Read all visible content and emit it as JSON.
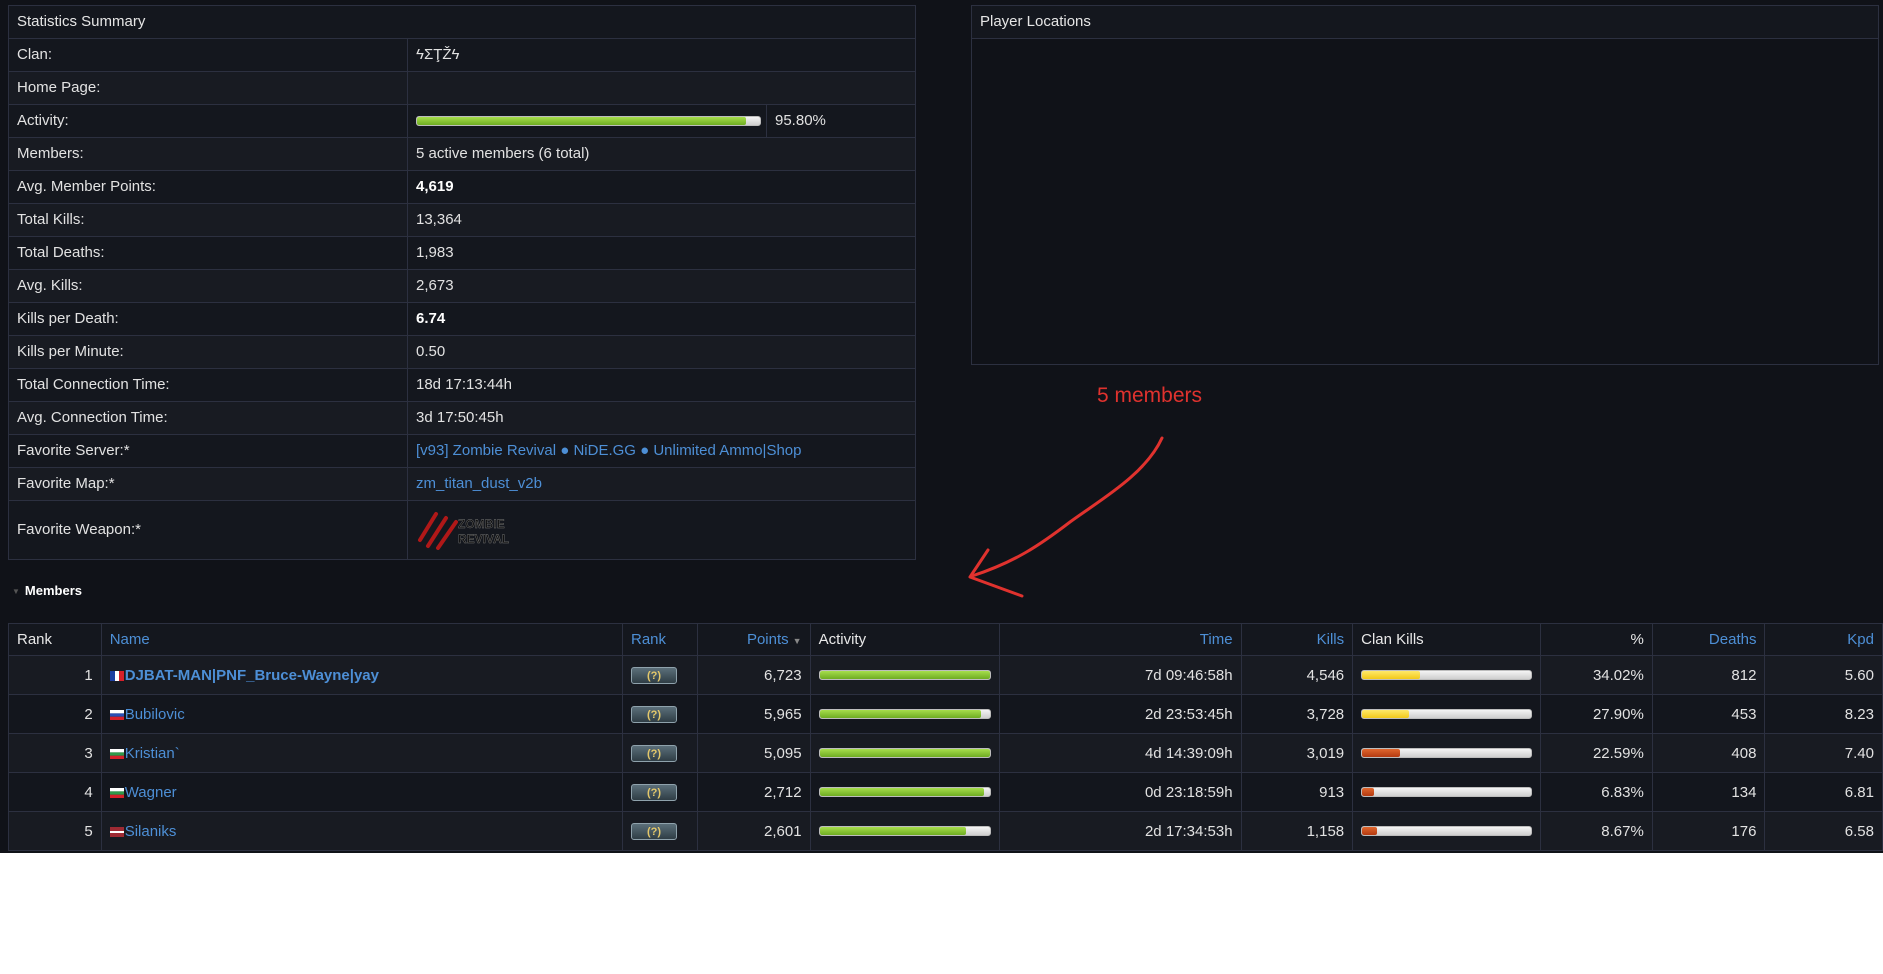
{
  "stats": {
    "title": "Statistics Summary",
    "rows": [
      {
        "label": "Clan:",
        "value": "ϟΣŢŽϟ"
      },
      {
        "label": "Home Page:",
        "value": ""
      },
      {
        "label": "Activity:",
        "activity_fraction": 0.958,
        "value": "95.80%"
      },
      {
        "label": "Members:",
        "value": "5 active members (6 total)"
      },
      {
        "label": "Avg. Member Points:",
        "value": "4,619"
      },
      {
        "label": "Total Kills:",
        "value": "13,364"
      },
      {
        "label": "Total Deaths:",
        "value": "1,983"
      },
      {
        "label": "Avg. Kills:",
        "value": "2,673"
      },
      {
        "label": "Kills per Death:",
        "value": "6.74"
      },
      {
        "label": "Kills per Minute:",
        "value": "0.50"
      },
      {
        "label": "Total Connection Time:",
        "value": "18d 17:13:44h"
      },
      {
        "label": "Avg. Connection Time:",
        "value": "3d 17:50:45h"
      },
      {
        "label": "Favorite Server:*",
        "value": "[v93] Zombie Revival ● NiDE.GG ● Unlimited Ammo|Shop"
      },
      {
        "label": "Favorite Map:*",
        "value": "zm_titan_dust_v2b"
      },
      {
        "label": "Favorite Weapon:*",
        "value": "ZOMBIE REVIVAL",
        "icon": "zombie-claw-weapon-icon"
      }
    ]
  },
  "locations": {
    "title": "Player Locations"
  },
  "annotation": {
    "text": "5 members",
    "color": "#e0322e"
  },
  "members": {
    "toggle_label": "Members",
    "columns": {
      "rank": "Rank",
      "name": "Name",
      "rank_badge": "Rank",
      "points": "Points",
      "activity": "Activity",
      "time": "Time",
      "kills": "Kills",
      "clan_kills": "Clan Kills",
      "percent": "%",
      "deaths": "Deaths",
      "kpd": "Kpd"
    },
    "rows": [
      {
        "rank": "1",
        "flag": "france-flag-icon",
        "name": "DJBAT-MAN|PNF_Bruce-Wayne|yay",
        "badge": "(?)",
        "points": "6,723",
        "activity_fraction": 1.0,
        "time": "7d 09:46:58h",
        "kills": "4,546",
        "clan_kills_fraction": 0.3402,
        "percent": "34.02%",
        "deaths": "812",
        "kpd": "5.60"
      },
      {
        "rank": "2",
        "flag": "slovenia-flag-icon",
        "name": "Bubilovic",
        "badge": "(?)",
        "points": "5,965",
        "activity_fraction": 0.95,
        "time": "2d 23:53:45h",
        "kills": "3,728",
        "clan_kills_fraction": 0.279,
        "percent": "27.90%",
        "deaths": "453",
        "kpd": "8.23"
      },
      {
        "rank": "3",
        "flag": "bulgaria-flag-icon",
        "name": "Kristian`",
        "badge": "(?)",
        "points": "5,095",
        "activity_fraction": 1.0,
        "time": "4d 14:39:09h",
        "kills": "3,019",
        "clan_kills_fraction": 0.2259,
        "percent": "22.59%",
        "deaths": "408",
        "kpd": "7.40"
      },
      {
        "rank": "4",
        "flag": "bulgaria-flag-icon",
        "name": "Wagner",
        "badge": "(?)",
        "points": "2,712",
        "activity_fraction": 0.97,
        "time": "0d 23:18:59h",
        "kills": "913",
        "clan_kills_fraction": 0.0683,
        "percent": "6.83%",
        "deaths": "134",
        "kpd": "6.81"
      },
      {
        "rank": "5",
        "flag": "latvia-flag-icon",
        "name": "Silaniks",
        "badge": "(?)",
        "points": "2,601",
        "activity_fraction": 0.86,
        "time": "2d 17:34:53h",
        "kills": "1,158",
        "clan_kills_fraction": 0.0867,
        "percent": "8.67%",
        "deaths": "176",
        "kpd": "6.58"
      }
    ]
  },
  "colors": {
    "background": "#101218",
    "link": "#4d8fd6",
    "activity": "#7cc02a",
    "clan_kill_high": "#f2c91a",
    "clan_kill_low": "#c0421a"
  }
}
